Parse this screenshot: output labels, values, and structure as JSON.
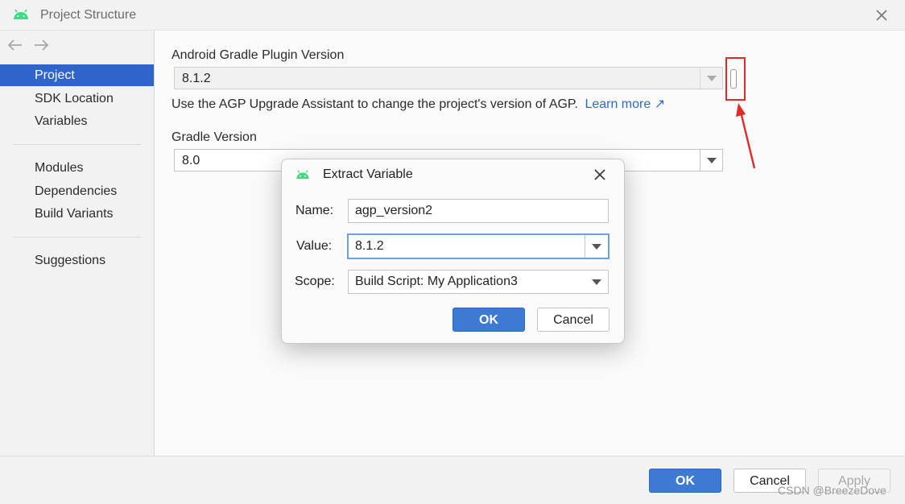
{
  "window": {
    "title": "Project Structure"
  },
  "sidebar": {
    "items": [
      {
        "label": "Project",
        "selected": true
      },
      {
        "label": "SDK Location"
      },
      {
        "label": "Variables"
      },
      {
        "label": "Modules"
      },
      {
        "label": "Dependencies"
      },
      {
        "label": "Build Variants"
      },
      {
        "label": "Suggestions"
      }
    ]
  },
  "main": {
    "agp_label": "Android Gradle Plugin Version",
    "agp_value": "8.1.2",
    "agp_helper": "Use the AGP Upgrade Assistant to change the project's version of AGP.",
    "learn_more": "Learn more ↗",
    "gradle_label": "Gradle Version",
    "gradle_value": "8.0"
  },
  "dialog": {
    "title": "Extract Variable",
    "name_label": "Name:",
    "name_value": "agp_version2",
    "value_label": "Value:",
    "value_value": "8.1.2",
    "scope_label": "Scope:",
    "scope_value": "Build Script: My Application3",
    "ok_label": "OK",
    "cancel_label": "Cancel"
  },
  "footer": {
    "ok_label": "OK",
    "cancel_label": "Cancel",
    "apply_label": "Apply"
  },
  "watermark": "CSDN @BreezeDove",
  "colors": {
    "accent": "#2f65ca",
    "android_green": "#3ddc84",
    "annotation_red": "#e02929"
  }
}
